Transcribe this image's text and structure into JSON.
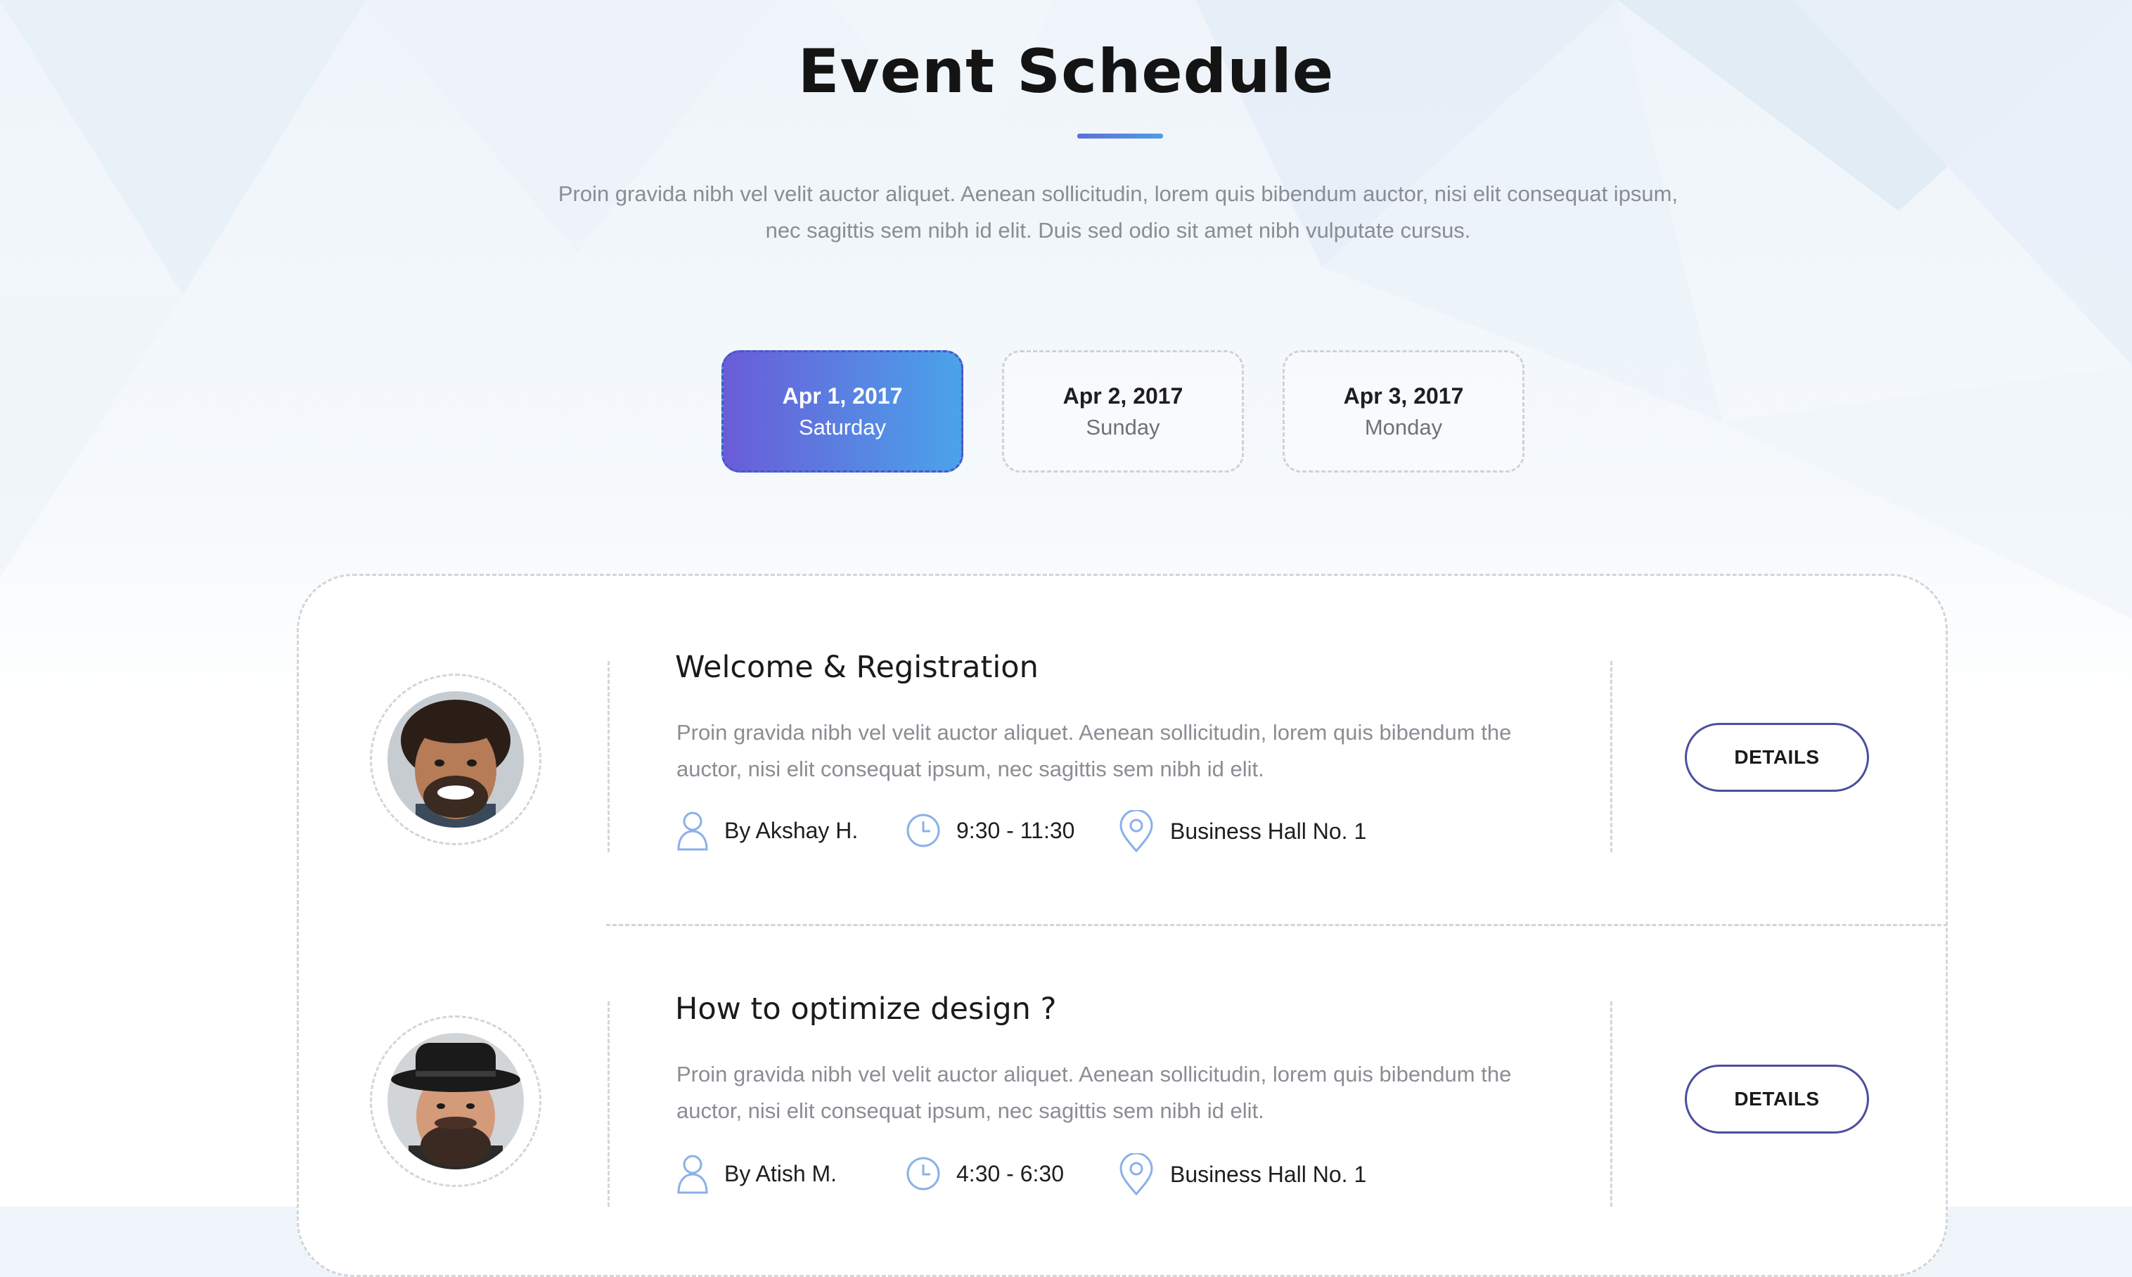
{
  "header": {
    "title": "Event Schedule",
    "intro": "Proin gravida nibh vel velit auctor aliquet. Aenean sollicitudin, lorem quis bibendum auctor, nisi elit consequat ipsum, nec sagittis sem nibh id elit. Duis sed odio sit amet nibh vulputate cursus."
  },
  "dates": [
    {
      "date": "Apr 1, 2017",
      "weekday": "Saturday",
      "active": true
    },
    {
      "date": "Apr 2, 2017",
      "weekday": "Sunday",
      "active": false
    },
    {
      "date": "Apr 3, 2017",
      "weekday": "Monday",
      "active": false
    }
  ],
  "sessions": [
    {
      "title": "Welcome & Registration",
      "description": "Proin gravida nibh vel velit auctor aliquet. Aenean sollicitudin, lorem quis bibendum the auctor, nisi elit consequat ipsum, nec sagittis sem nibh id elit.",
      "speaker": "By Akshay H.",
      "time": "9:30 - 11:30",
      "location": "Business Hall No. 1",
      "details_label": "DETAILS"
    },
    {
      "title": "How to optimize design ?",
      "description": "Proin gravida nibh vel velit auctor aliquet. Aenean sollicitudin, lorem quis bibendum the auctor, nisi elit consequat ipsum, nec sagittis sem nibh id elit.",
      "speaker": "By Atish M.",
      "time": "4:30 - 6:30",
      "location": "Business Hall No. 1",
      "details_label": "DETAILS"
    }
  ],
  "colors": {
    "accent_start": "#6a5cd8",
    "accent_end": "#4aa3ea",
    "button_border": "#4b4f9c",
    "icon_blue": "#8bb0e8"
  },
  "icons": [
    "user-icon",
    "clock-icon",
    "location-pin-icon"
  ]
}
